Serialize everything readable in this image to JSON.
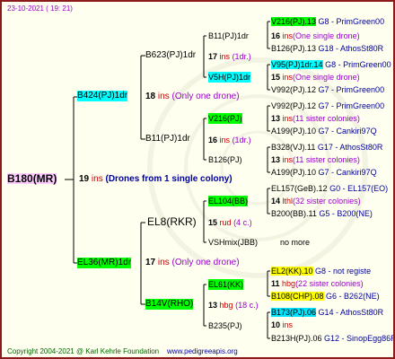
{
  "header": {
    "date": "23-10-2021 ( 19: 21)"
  },
  "footer": {
    "copyright": "Copyright 2004-2021 @ Karl Kehrle Foundation",
    "site": "www.pedigreeapis.org"
  },
  "colors": {
    "frame": "#8b1a1a",
    "pink": "#ffccff",
    "cyan": "#00ffff",
    "green": "#00ff00",
    "yellow": "#ffff00",
    "blue_box": "#00e5ff"
  },
  "root": {
    "id": "B180(MR)",
    "ins_num": "19",
    "ins_label": "ins",
    "note": "(Drones from 1 single colony)"
  },
  "gen1": [
    {
      "id": "B424(PJ)1dr",
      "num": "18",
      "label": "ins",
      "note": "(Only one drone)"
    },
    {
      "id": "EL36(MR)1dr",
      "num": "17",
      "label": "ins",
      "note": "(Only one drone)"
    }
  ],
  "gen2": [
    {
      "id": "B623(PJ)1dr",
      "num": "17",
      "label": "ins",
      "note": "(1dr.)"
    },
    {
      "id": "B11(PJ)1dr",
      "num": "16",
      "label": "ins",
      "note": "(1dr.)"
    },
    {
      "id": "EL8(RKR)",
      "num": "15",
      "label": "rud",
      "note": "(4 c.)"
    },
    {
      "id": "B14V(RHO)",
      "num": "13",
      "label": "hbg",
      "note": "(18 c.)"
    }
  ],
  "gen3": [
    {
      "id": "B11(PJ)1dr"
    },
    {
      "id": "V5H(PJ)1dr"
    },
    {
      "id": "V216(PJ)",
      "num": "13",
      "label": "ins",
      "note": "(11 sister colonies)"
    },
    {
      "id": "B126(PJ)"
    },
    {
      "id": "EL104(BB)",
      "num": "14",
      "label": "lthl",
      "note": "(32 sister colonies)"
    },
    {
      "id": "VSHmix(JBB)",
      "nomore": "no more"
    },
    {
      "id": "EL61(KK)"
    },
    {
      "id": "B235(PJ)"
    }
  ],
  "gen4": [
    {
      "id": "V216(PJ).13",
      "tail": "G8 - PrimGreen00"
    },
    {
      "id": "16",
      "mid": "ins",
      "tail": "(One single drone)"
    },
    {
      "id": "B126(PJ).13",
      "tail": "G18 - AthosSt80R"
    },
    {
      "id": "V95(PJ)1dr.14",
      "tail": "G8 - PrimGreen00"
    },
    {
      "id": "15",
      "mid": "ins",
      "tail": "(One single drone)"
    },
    {
      "id": "V992(PJ).12",
      "tail": "G7 - PrimGreen00"
    },
    {
      "id": "V992(PJ).12",
      "tail": "G7 - PrimGreen00"
    },
    {
      "id": "A199(PJ).10",
      "tail": "G7 - Cankiri97Q"
    },
    {
      "id": "B328(VJ).11",
      "tail": "G17 - AthosSt80R"
    },
    {
      "id": "13",
      "mid": "ins",
      "tail": "(11 sister colonies)"
    },
    {
      "id": "A199(PJ).10",
      "tail": "G7 - Cankiri97Q"
    },
    {
      "id": "EL157(GeB).12",
      "tail": "G0 - EL157(EO)"
    },
    {
      "id": "B200(BB).11",
      "tail": "G5 - B200(NE)"
    },
    {
      "id": "EL2(KK).10",
      "tail": "G8 - not registe"
    },
    {
      "id": "11",
      "mid": "hbg",
      "tail": "(22 sister colonies)"
    },
    {
      "id": "B108(CHP).08",
      "tail": "G6 - B262(NE)"
    },
    {
      "id": "B173(PJ).06",
      "tail": "G14 - AthosSt80R"
    },
    {
      "id": "10",
      "mid": "ins"
    },
    {
      "id": "B213H(PJ).06",
      "tail": "G12 - SinopEgg86R"
    }
  ]
}
